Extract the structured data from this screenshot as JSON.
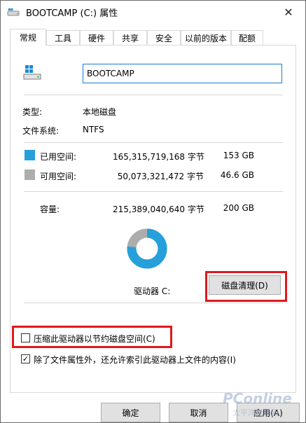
{
  "window": {
    "title": "BOOTCAMP (C:) 属性",
    "close_glyph": "✕"
  },
  "tabs": [
    {
      "label": "常规"
    },
    {
      "label": "工具"
    },
    {
      "label": "硬件"
    },
    {
      "label": "共享"
    },
    {
      "label": "安全"
    },
    {
      "label": "以前的版本"
    },
    {
      "label": "配额"
    }
  ],
  "general": {
    "drive_name": "BOOTCAMP",
    "type_label": "类型:",
    "type_value": "本地磁盘",
    "fs_label": "文件系统:",
    "fs_value": "NTFS",
    "used_label": "已用空间:",
    "used_bytes": "165,315,719,168 字节",
    "used_gb": "153 GB",
    "free_label": "可用空间:",
    "free_bytes": "50,073,321,472 字节",
    "free_gb": "46.6 GB",
    "capacity_label": "容量:",
    "capacity_bytes": "215,389,040,640 字节",
    "capacity_gb": "200 GB",
    "drive_label": "驱动器 C:",
    "cleanup_button": "磁盘清理(D)",
    "compress_label": "压缩此驱动器以节约磁盘空间(C)",
    "index_label": "除了文件属性外，还允许索引此驱动器上文件的内容(I)",
    "compress_checked": false,
    "index_checked": true,
    "used_fraction": 0.7675
  },
  "colors": {
    "used": "#26a0da",
    "free": "#adadad",
    "highlight": "#e0191c"
  },
  "buttons": {
    "ok": "确定",
    "cancel": "取消",
    "apply": "应用(A)"
  },
  "watermark": {
    "brand": "PConline",
    "sub": "太平洋电脑网"
  }
}
